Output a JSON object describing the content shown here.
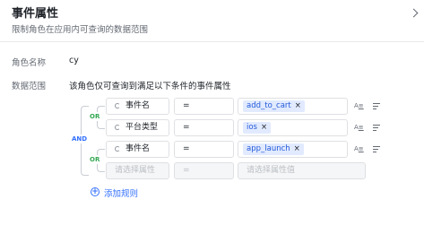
{
  "header": {
    "title": "事件属性",
    "subtitle": "限制角色在应用内可查询的数据范围"
  },
  "role": {
    "label": "角色名称",
    "value": "cy"
  },
  "scope": {
    "label": "数据范围",
    "description": "该角色仅可查询到满足以下条件的事件属性"
  },
  "operators": {
    "or": "OR",
    "and": "AND"
  },
  "rows": [
    {
      "field": "事件名",
      "op": "=",
      "value": "add_to_cart"
    },
    {
      "field": "平台类型",
      "op": "=",
      "value": "ios"
    },
    {
      "field": "事件名",
      "op": "=",
      "value": "app_launch"
    }
  ],
  "empty_row": {
    "field_placeholder": "请选择属性",
    "op": "=",
    "value_placeholder": "请选择属性值"
  },
  "add_rule": "添加规则",
  "icons": {
    "tag_remove": "×",
    "row_action_a": "A≡"
  }
}
